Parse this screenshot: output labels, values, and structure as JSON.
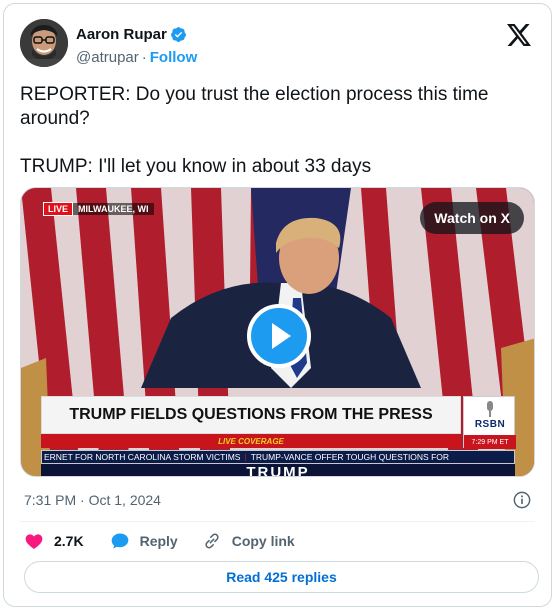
{
  "author": {
    "name": "Aaron Rupar",
    "handle": "@atrupar",
    "follow_label": "Follow"
  },
  "tweet": {
    "text": "REPORTER: Do you trust the election process this time around?\n\nTRUMP: I'll let you know in about 33 days"
  },
  "video": {
    "live_label": "LIVE",
    "location": "MILWAUKEE, WI",
    "watch_label": "Watch on X",
    "headline": "TRUMP FIELDS QUESTIONS FROM THE PRESS",
    "coverage_label": "LIVE COVERAGE",
    "channel_logo": "RSBN",
    "channel_time": "7:29 PM ET",
    "ticker_1": "ERNET FOR NORTH CAROLINA STORM VICTIMS",
    "ticker_2": "TRUMP-VANCE OFFER TOUGH QUESTIONS FOR",
    "bottom_text": "TRUMP"
  },
  "meta": {
    "timestamp": "7:31 PM · Oct 1, 2024"
  },
  "actions": {
    "likes": "2.7K",
    "reply_label": "Reply",
    "copy_label": "Copy link"
  },
  "footer": {
    "read_replies_label": "Read 425 replies"
  },
  "colors": {
    "accent": "#1d9bf0",
    "like": "#f91880",
    "link": "#006fd6",
    "muted": "#536471"
  },
  "icons": [
    "verified-badge-icon",
    "x-logo-icon",
    "play-icon",
    "heart-icon",
    "reply-bubble-icon",
    "link-icon",
    "info-icon"
  ]
}
